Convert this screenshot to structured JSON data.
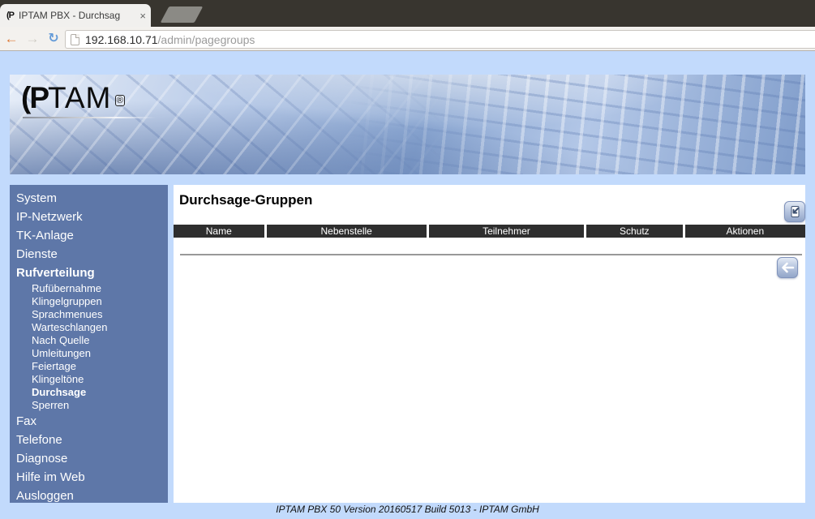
{
  "browser": {
    "tab_title": "IPTAM PBX - Durchsag",
    "tab_close_glyph": "×",
    "favicon_glyph": "(P",
    "back_glyph": "←",
    "forward_glyph": "→",
    "reload_glyph": "↻",
    "url_host": "192.168.10.71",
    "url_path": "/admin/pagegroups"
  },
  "header": {
    "logo_ip": "(P",
    "logo_tam": "TAM",
    "logo_reg": "®"
  },
  "sidebar": {
    "items": [
      {
        "label": "System"
      },
      {
        "label": "IP-Netzwerk"
      },
      {
        "label": "TK-Anlage"
      },
      {
        "label": "Dienste"
      },
      {
        "label": "Rufverteilung"
      },
      {
        "label": "Rufübernahme"
      },
      {
        "label": "Klingelgruppen"
      },
      {
        "label": "Sprachmenues"
      },
      {
        "label": "Warteschlangen"
      },
      {
        "label": "Nach Quelle"
      },
      {
        "label": "Umleitungen"
      },
      {
        "label": "Feiertage"
      },
      {
        "label": "Klingeltöne"
      },
      {
        "label": "Durchsage"
      },
      {
        "label": "Sperren"
      },
      {
        "label": "Fax"
      },
      {
        "label": "Telefone"
      },
      {
        "label": "Diagnose"
      },
      {
        "label": "Hilfe im Web"
      },
      {
        "label": "Ausloggen"
      }
    ]
  },
  "main": {
    "title": "Durchsage-Gruppen",
    "table_headers": [
      "Name",
      "Nebenstelle",
      "Teilnehmer",
      "Schutz",
      "Aktionen"
    ]
  },
  "footer": {
    "text": "IPTAM PBX 50 Version 20160517 Build 5013 - IPTAM GmbH"
  },
  "colors": {
    "titlebar-bg": "#38352f",
    "tab-bg": "#f1f0ee",
    "toolbar-bg": "#f3f1ee",
    "page-bg": "#c2dafc",
    "sidebar-bg": "#5e77a8",
    "thead-bg": "#2e2e2e",
    "btn-border": "#8093bb"
  }
}
